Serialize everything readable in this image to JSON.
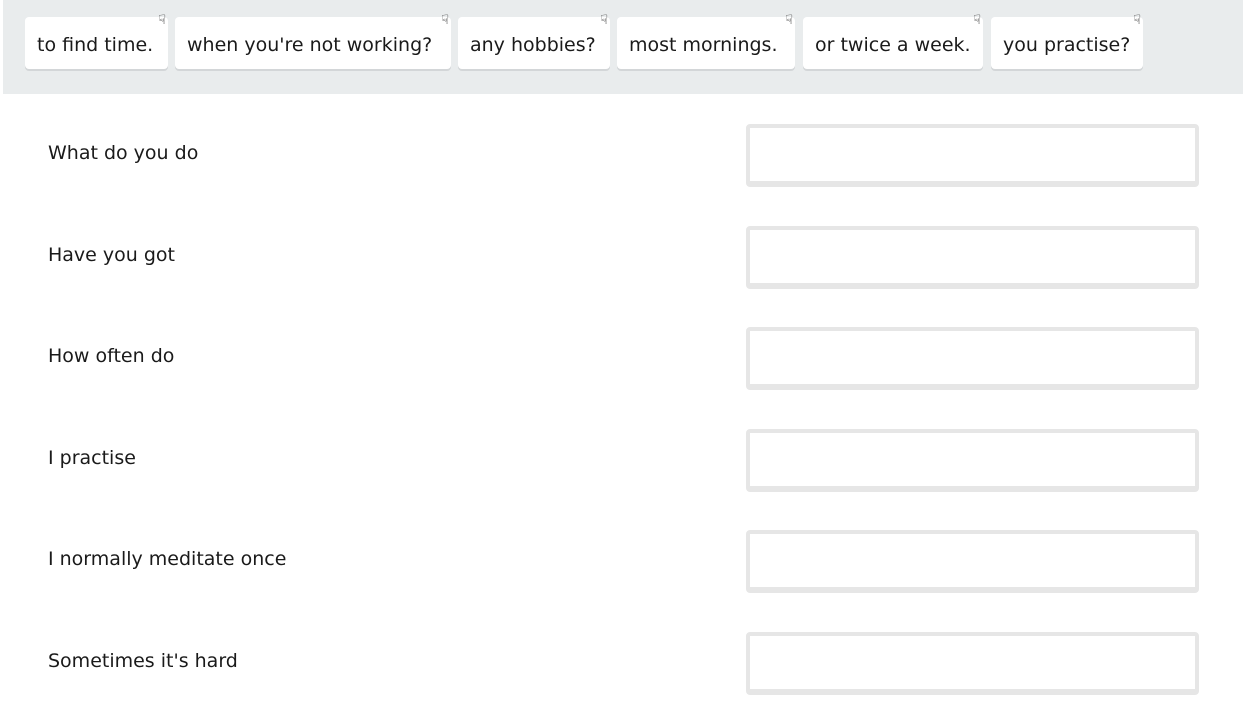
{
  "word_bank": [
    {
      "label": "to find time.",
      "icon": "hand-pointing-down-icon"
    },
    {
      "label": "when you're not working?",
      "icon": "hand-pointing-down-icon"
    },
    {
      "label": "any hobbies?",
      "icon": "hand-pointing-down-icon"
    },
    {
      "label": "most mornings.",
      "icon": "hand-pointing-down-icon"
    },
    {
      "label": "or twice a week.",
      "icon": "hand-pointing-down-icon"
    },
    {
      "label": "you practise?",
      "icon": "hand-pointing-down-icon"
    }
  ],
  "rows": [
    {
      "prompt": "What do you do",
      "answer": ""
    },
    {
      "prompt": "Have you got",
      "answer": ""
    },
    {
      "prompt": "How often do",
      "answer": ""
    },
    {
      "prompt": "I practise",
      "answer": ""
    },
    {
      "prompt": "I normally meditate once",
      "answer": ""
    },
    {
      "prompt": "Sometimes it's hard",
      "answer": ""
    }
  ]
}
